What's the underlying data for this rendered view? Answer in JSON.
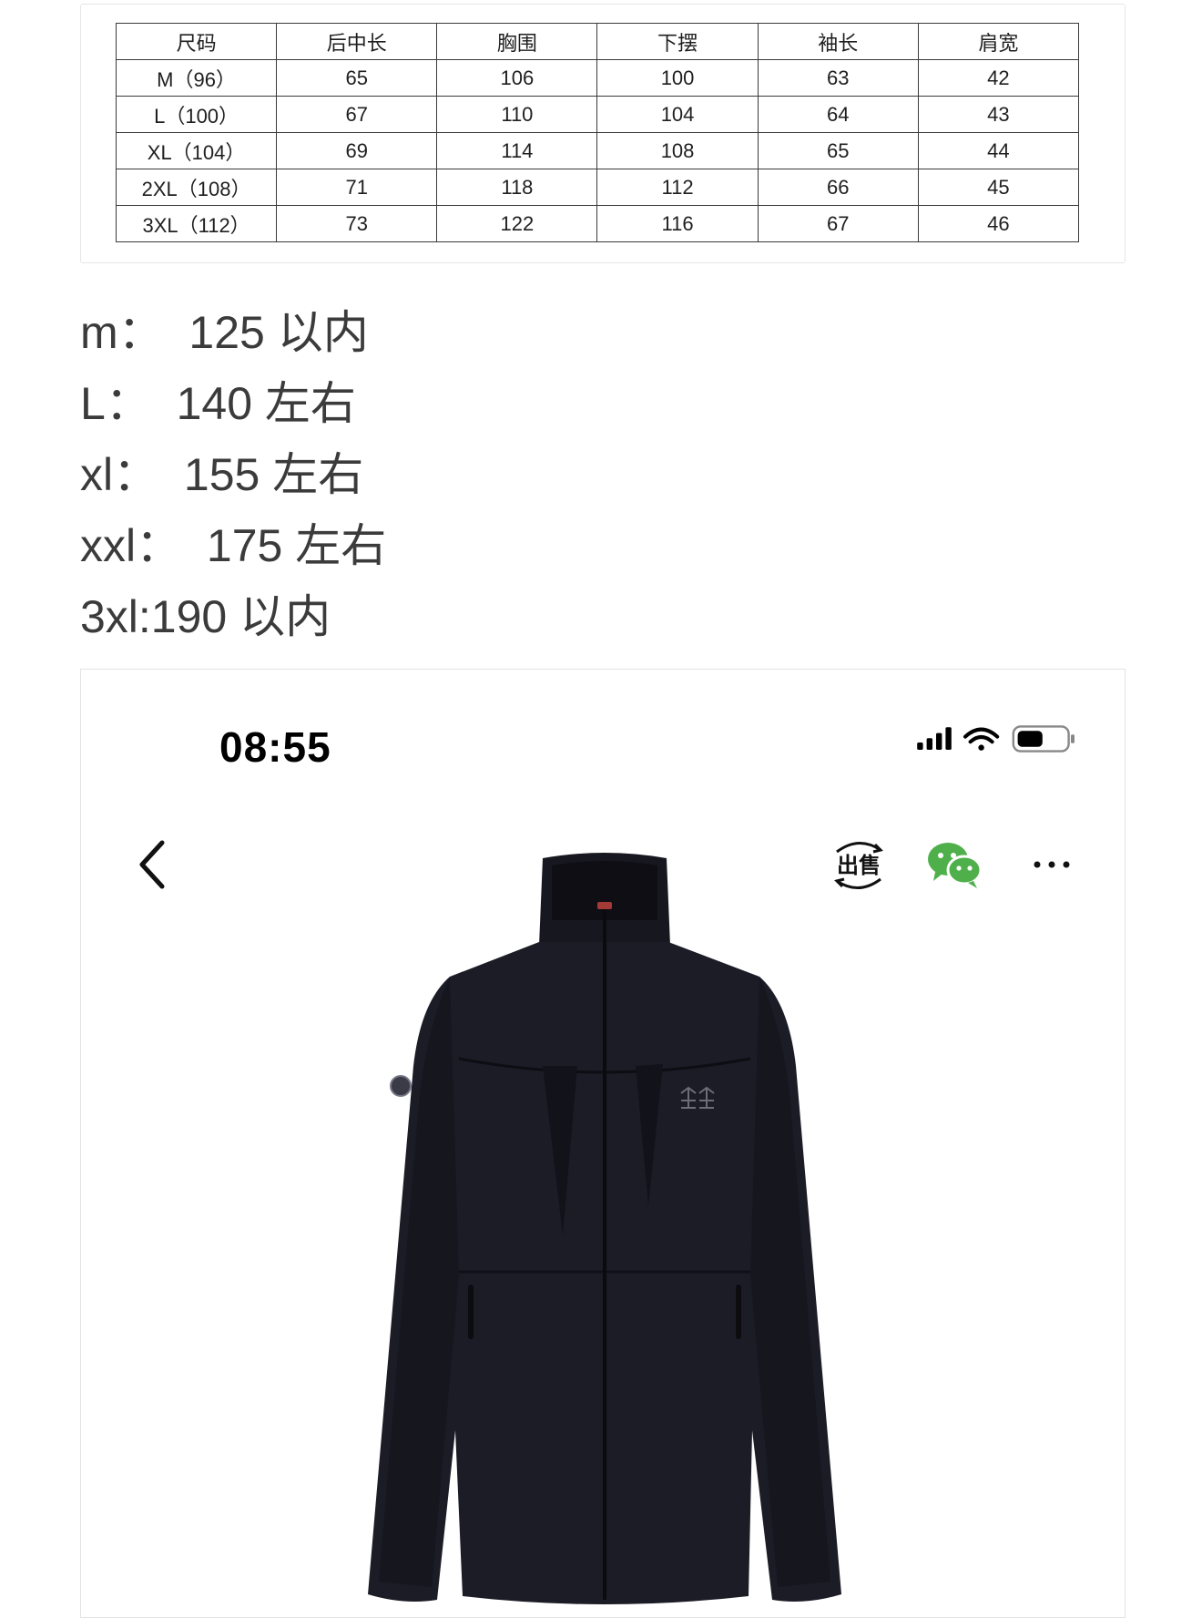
{
  "size_table": {
    "headers": [
      "尺码",
      "后中长",
      "胸围",
      "下摆",
      "袖长",
      "肩宽"
    ],
    "rows": [
      [
        "M（96）",
        "65",
        "106",
        "100",
        "63",
        "42"
      ],
      [
        "L（100）",
        "67",
        "110",
        "104",
        "64",
        "43"
      ],
      [
        "XL（104）",
        "69",
        "114",
        "108",
        "65",
        "44"
      ],
      [
        "2XL（108）",
        "71",
        "118",
        "112",
        "66",
        "45"
      ],
      [
        "3XL（112）",
        "73",
        "122",
        "116",
        "67",
        "46"
      ]
    ]
  },
  "fit_notes": [
    "m：  125 以内",
    "L：  140 左右",
    "xl：  155 左右",
    "xxl：  175 左右",
    "3xl:190 以内"
  ],
  "phone": {
    "time": "08:55",
    "icons": [
      "signal-icon",
      "wifi-icon",
      "battery-icon"
    ],
    "nav": {
      "back_icon": "chevron-left-icon",
      "sell_label": "出售",
      "wechat_icon": "wechat-icon",
      "more_icon": "more-icon"
    },
    "product_image": "black-softshell-jacket",
    "accent_wechat": "#4fb04b"
  }
}
